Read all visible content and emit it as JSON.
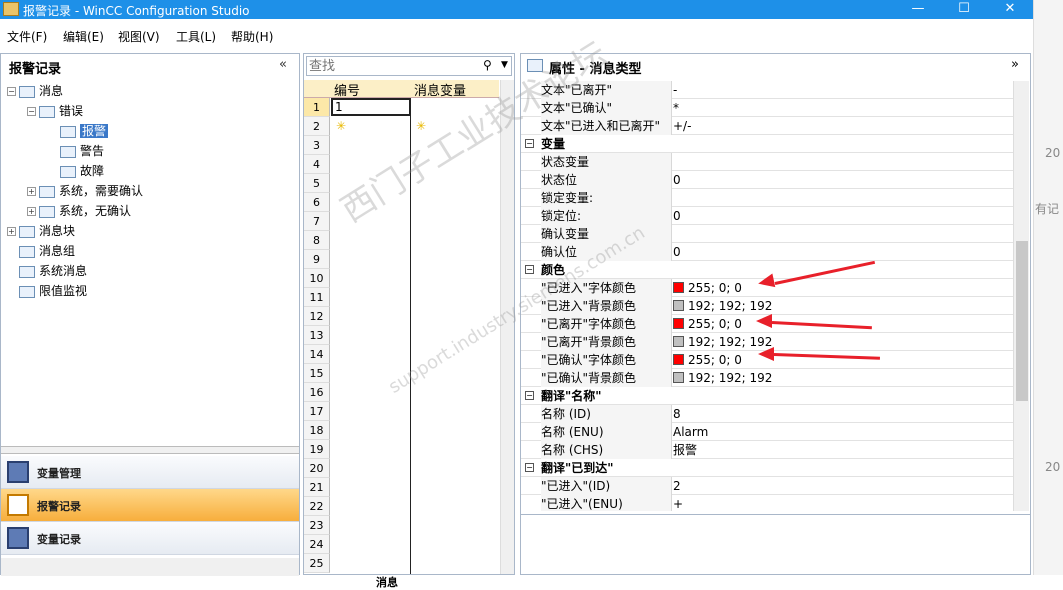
{
  "window": {
    "title": "报警记录 - WinCC Configuration Studio",
    "minimize": "—",
    "maximize": "☐",
    "close": "✕"
  },
  "menu": [
    "文件(F)",
    "编辑(E)",
    "视图(V)",
    "工具(L)",
    "帮助(H)"
  ],
  "left_panel": {
    "title": "报警记录",
    "collapse": "«",
    "tree": [
      {
        "label": "消息",
        "level": 0,
        "expander": "−"
      },
      {
        "label": "错误",
        "level": 1,
        "expander": "−"
      },
      {
        "label": "报警",
        "level": 2,
        "selected": true
      },
      {
        "label": "警告",
        "level": 2
      },
      {
        "label": "故障",
        "level": 2
      },
      {
        "label": "系统，需要确认",
        "level": 1,
        "expander": "+"
      },
      {
        "label": "系统，无确认",
        "level": 1,
        "expander": "+"
      },
      {
        "label": "消息块",
        "level": 0,
        "expander": "+"
      },
      {
        "label": "消息组",
        "level": 0
      },
      {
        "label": "系统消息",
        "level": 0
      },
      {
        "label": "限值监视",
        "level": 0
      }
    ],
    "nav": [
      {
        "label": "变量管理",
        "active": false
      },
      {
        "label": "报警记录",
        "active": true
      },
      {
        "label": "变量记录",
        "active": false
      }
    ]
  },
  "mid_panel": {
    "search_placeholder": "查找",
    "columns": [
      "编号",
      "消息变量"
    ],
    "first_row_value": "1",
    "row_numbers": [
      "1",
      "2",
      "3",
      "4",
      "5",
      "6",
      "7",
      "8",
      "9",
      "10",
      "11",
      "12",
      "13",
      "14",
      "15",
      "16",
      "17",
      "18",
      "19",
      "20",
      "21",
      "22",
      "23",
      "24",
      "25"
    ],
    "bottom_tab": "消息"
  },
  "right_panel": {
    "title": "属性 - 消息类型",
    "expand": "»",
    "rows": [
      {
        "type": "prop",
        "key": "文本\"已离开\"",
        "value": "-"
      },
      {
        "type": "prop",
        "key": "文本\"已确认\"",
        "value": "*"
      },
      {
        "type": "prop",
        "key": "文本\"已进入和已离开\"",
        "value": "+/-"
      },
      {
        "type": "cat",
        "key": "变量"
      },
      {
        "type": "prop",
        "key": "状态变量",
        "value": ""
      },
      {
        "type": "prop",
        "key": "状态位",
        "value": "0"
      },
      {
        "type": "prop",
        "key": "锁定变量:",
        "value": ""
      },
      {
        "type": "prop",
        "key": "锁定位:",
        "value": "0"
      },
      {
        "type": "prop",
        "key": "确认变量",
        "value": ""
      },
      {
        "type": "prop",
        "key": "确认位",
        "value": "0"
      },
      {
        "type": "cat",
        "key": "颜色"
      },
      {
        "type": "color",
        "key": "\"已进入\"字体颜色",
        "value": "255; 0; 0",
        "swatch": "#ff0000"
      },
      {
        "type": "color",
        "key": "\"已进入\"背景颜色",
        "value": "192; 192; 192",
        "swatch": "#c0c0c0"
      },
      {
        "type": "color",
        "key": "\"已离开\"字体颜色",
        "value": "255; 0; 0",
        "swatch": "#ff0000"
      },
      {
        "type": "color",
        "key": "\"已离开\"背景颜色",
        "value": "192; 192; 192",
        "swatch": "#c0c0c0"
      },
      {
        "type": "color",
        "key": "\"已确认\"字体颜色",
        "value": "255; 0; 0",
        "swatch": "#ff0000"
      },
      {
        "type": "color",
        "key": "\"已确认\"背景颜色",
        "value": "192; 192; 192",
        "swatch": "#c0c0c0"
      },
      {
        "type": "cat",
        "key": "翻译\"名称\""
      },
      {
        "type": "prop",
        "key": "名称 (ID)",
        "value": "8"
      },
      {
        "type": "prop",
        "key": "名称 (ENU)",
        "value": "Alarm"
      },
      {
        "type": "prop",
        "key": "名称 (CHS)",
        "value": "报警"
      },
      {
        "type": "cat",
        "key": "翻译\"已到达\""
      },
      {
        "type": "prop",
        "key": "\"已进入\"(ID)",
        "value": "2"
      },
      {
        "type": "prop",
        "key": "\"已进入\"(ENU)",
        "value": "+"
      }
    ]
  },
  "right_strip": [
    "20",
    "有记",
    "20"
  ],
  "watermark": {
    "line1": "西门子工业技术论坛",
    "line2": "support.industry.siemens.com.cn"
  },
  "colors": {
    "titlebar": "#1e90e8",
    "selection": "#3a78c8",
    "active_nav": "#f7ae3c",
    "annotation_arrow": "#e8202a"
  }
}
